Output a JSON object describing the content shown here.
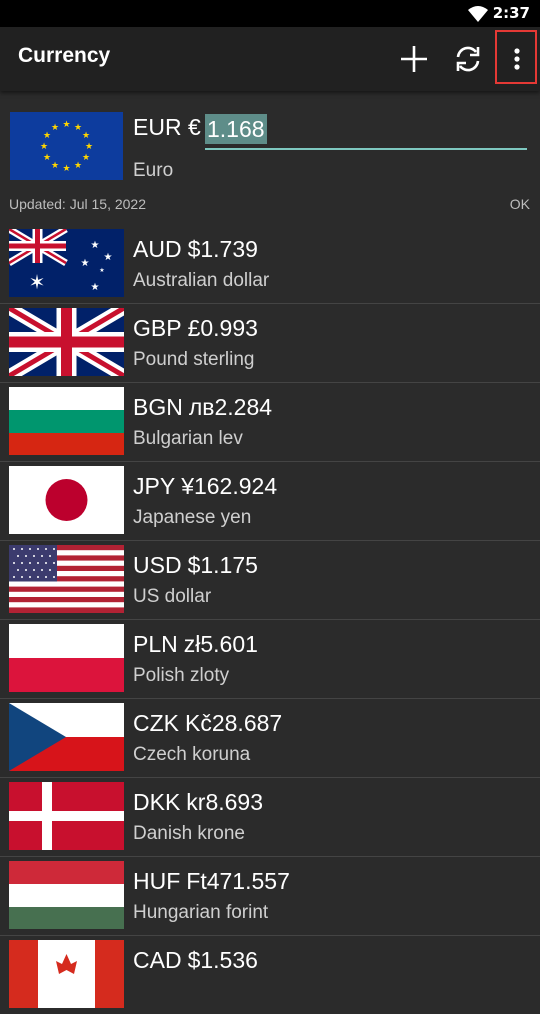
{
  "status_bar": {
    "time": "2:37",
    "wifi_icon": "wifi-icon"
  },
  "app_bar": {
    "title": "Currency",
    "add_icon": "plus-icon",
    "refresh_icon": "refresh-icon",
    "more_icon": "more-vertical-icon"
  },
  "base": {
    "code": "EUR",
    "symbol": "€",
    "value": "1.168",
    "name": "Euro",
    "flag": "eu-flag"
  },
  "updated": "Updated: Jul 15, 2022",
  "status_ok": "OK",
  "currencies": [
    {
      "code": "AUD",
      "amount": "$1.739",
      "name": "Australian dollar",
      "flag": "au-flag"
    },
    {
      "code": "GBP",
      "amount": "£0.993",
      "name": "Pound sterling",
      "flag": "gb-flag"
    },
    {
      "code": "BGN",
      "amount": "лв2.284",
      "name": "Bulgarian lev",
      "flag": "bg-flag"
    },
    {
      "code": "JPY",
      "amount": "¥162.924",
      "name": "Japanese yen",
      "flag": "jp-flag"
    },
    {
      "code": "USD",
      "amount": "$1.175",
      "name": "US dollar",
      "flag": "us-flag"
    },
    {
      "code": "PLN",
      "amount": "zł5.601",
      "name": "Polish zloty",
      "flag": "pl-flag"
    },
    {
      "code": "CZK",
      "amount": "Kč28.687",
      "name": "Czech koruna",
      "flag": "cz-flag"
    },
    {
      "code": "DKK",
      "amount": "kr8.693",
      "name": "Danish krone",
      "flag": "dk-flag"
    },
    {
      "code": "HUF",
      "amount": "Ft471.557",
      "name": "Hungarian forint",
      "flag": "hu-flag"
    },
    {
      "code": "CAD",
      "amount": "$1.536",
      "name": "",
      "flag": "ca-flag"
    }
  ]
}
